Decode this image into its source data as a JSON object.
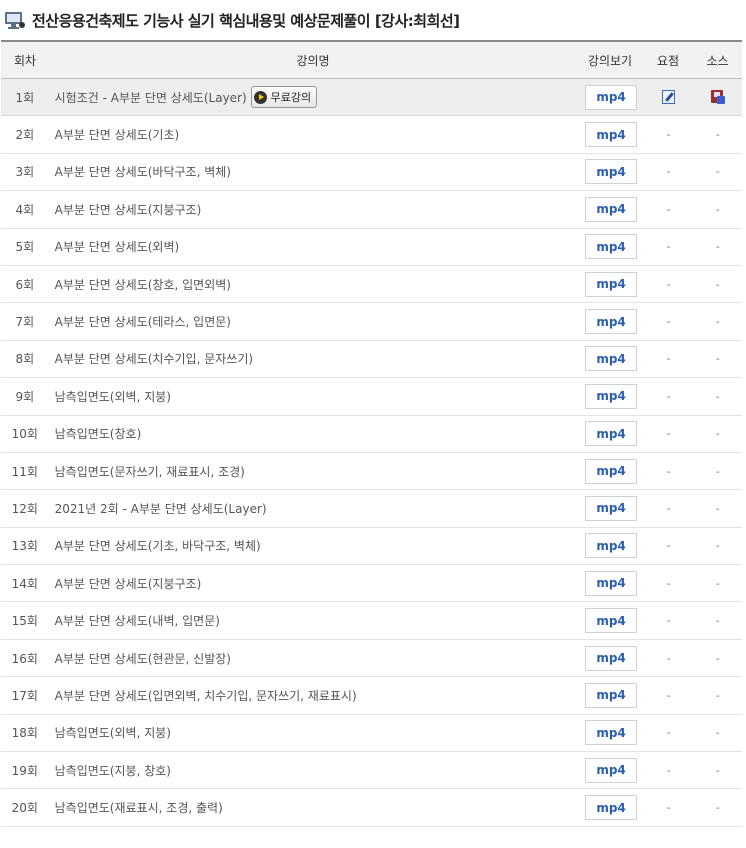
{
  "header": {
    "title": "전산응용건축제도 기능사 실기 핵심내용및 예상문제풀이 [강사:최희선]"
  },
  "columns": {
    "no": "회차",
    "title": "강의명",
    "view": "강의보기",
    "note": "요점",
    "source": "소스"
  },
  "free_label": "무료강의",
  "mp4_label": "mp4",
  "dash": "-",
  "rows": [
    {
      "no": "1회",
      "title": "시험조건 - A부분 단면 상세도(Layer)"
    },
    {
      "no": "2회",
      "title": "A부분 단면 상세도(기초)"
    },
    {
      "no": "3회",
      "title": "A부분 단면 상세도(바닥구조, 벽체)"
    },
    {
      "no": "4회",
      "title": "A부분 단면 상세도(지붕구조)"
    },
    {
      "no": "5회",
      "title": "A부분 단면 상세도(외벽)"
    },
    {
      "no": "6회",
      "title": "A부분 단면 상세도(창호, 입면외벽)"
    },
    {
      "no": "7회",
      "title": "A부분 단면 상세도(테라스, 입면문)"
    },
    {
      "no": "8회",
      "title": "A부분 단면 상세도(치수기입, 문자쓰기)"
    },
    {
      "no": "9회",
      "title": "남측입면도(외벽, 지붕)"
    },
    {
      "no": "10회",
      "title": "남측입면도(창호)"
    },
    {
      "no": "11회",
      "title": "남측입면도(문자쓰기, 재료표시, 조경)"
    },
    {
      "no": "12회",
      "title": "2021년 2회 - A부분 단면 상세도(Layer)"
    },
    {
      "no": "13회",
      "title": "A부분 단면 상세도(기초, 바닥구조, 벽체)"
    },
    {
      "no": "14회",
      "title": "A부분 단면 상세도(지붕구조)"
    },
    {
      "no": "15회",
      "title": "A부분 단면 상세도(내벽, 입면문)"
    },
    {
      "no": "16회",
      "title": "A부분 단면 상세도(현관문, 신발장)"
    },
    {
      "no": "17회",
      "title": "A부분 단면 상세도(입면외벽, 치수기입, 문자쓰기, 재료표시)"
    },
    {
      "no": "18회",
      "title": "남측입면도(외벽, 지붕)"
    },
    {
      "no": "19회",
      "title": "남측입면도(지붕, 창호)"
    },
    {
      "no": "20회",
      "title": "남측입면도(재료표시, 조경, 출력)"
    }
  ],
  "first_row_icons": {
    "note": "memo-edit-icon",
    "source": "source-file-icon"
  },
  "colors": {
    "mp4": "#2a5fb0",
    "header_bg": "#f2f2f2",
    "highlight_row": "#eeeeee"
  }
}
